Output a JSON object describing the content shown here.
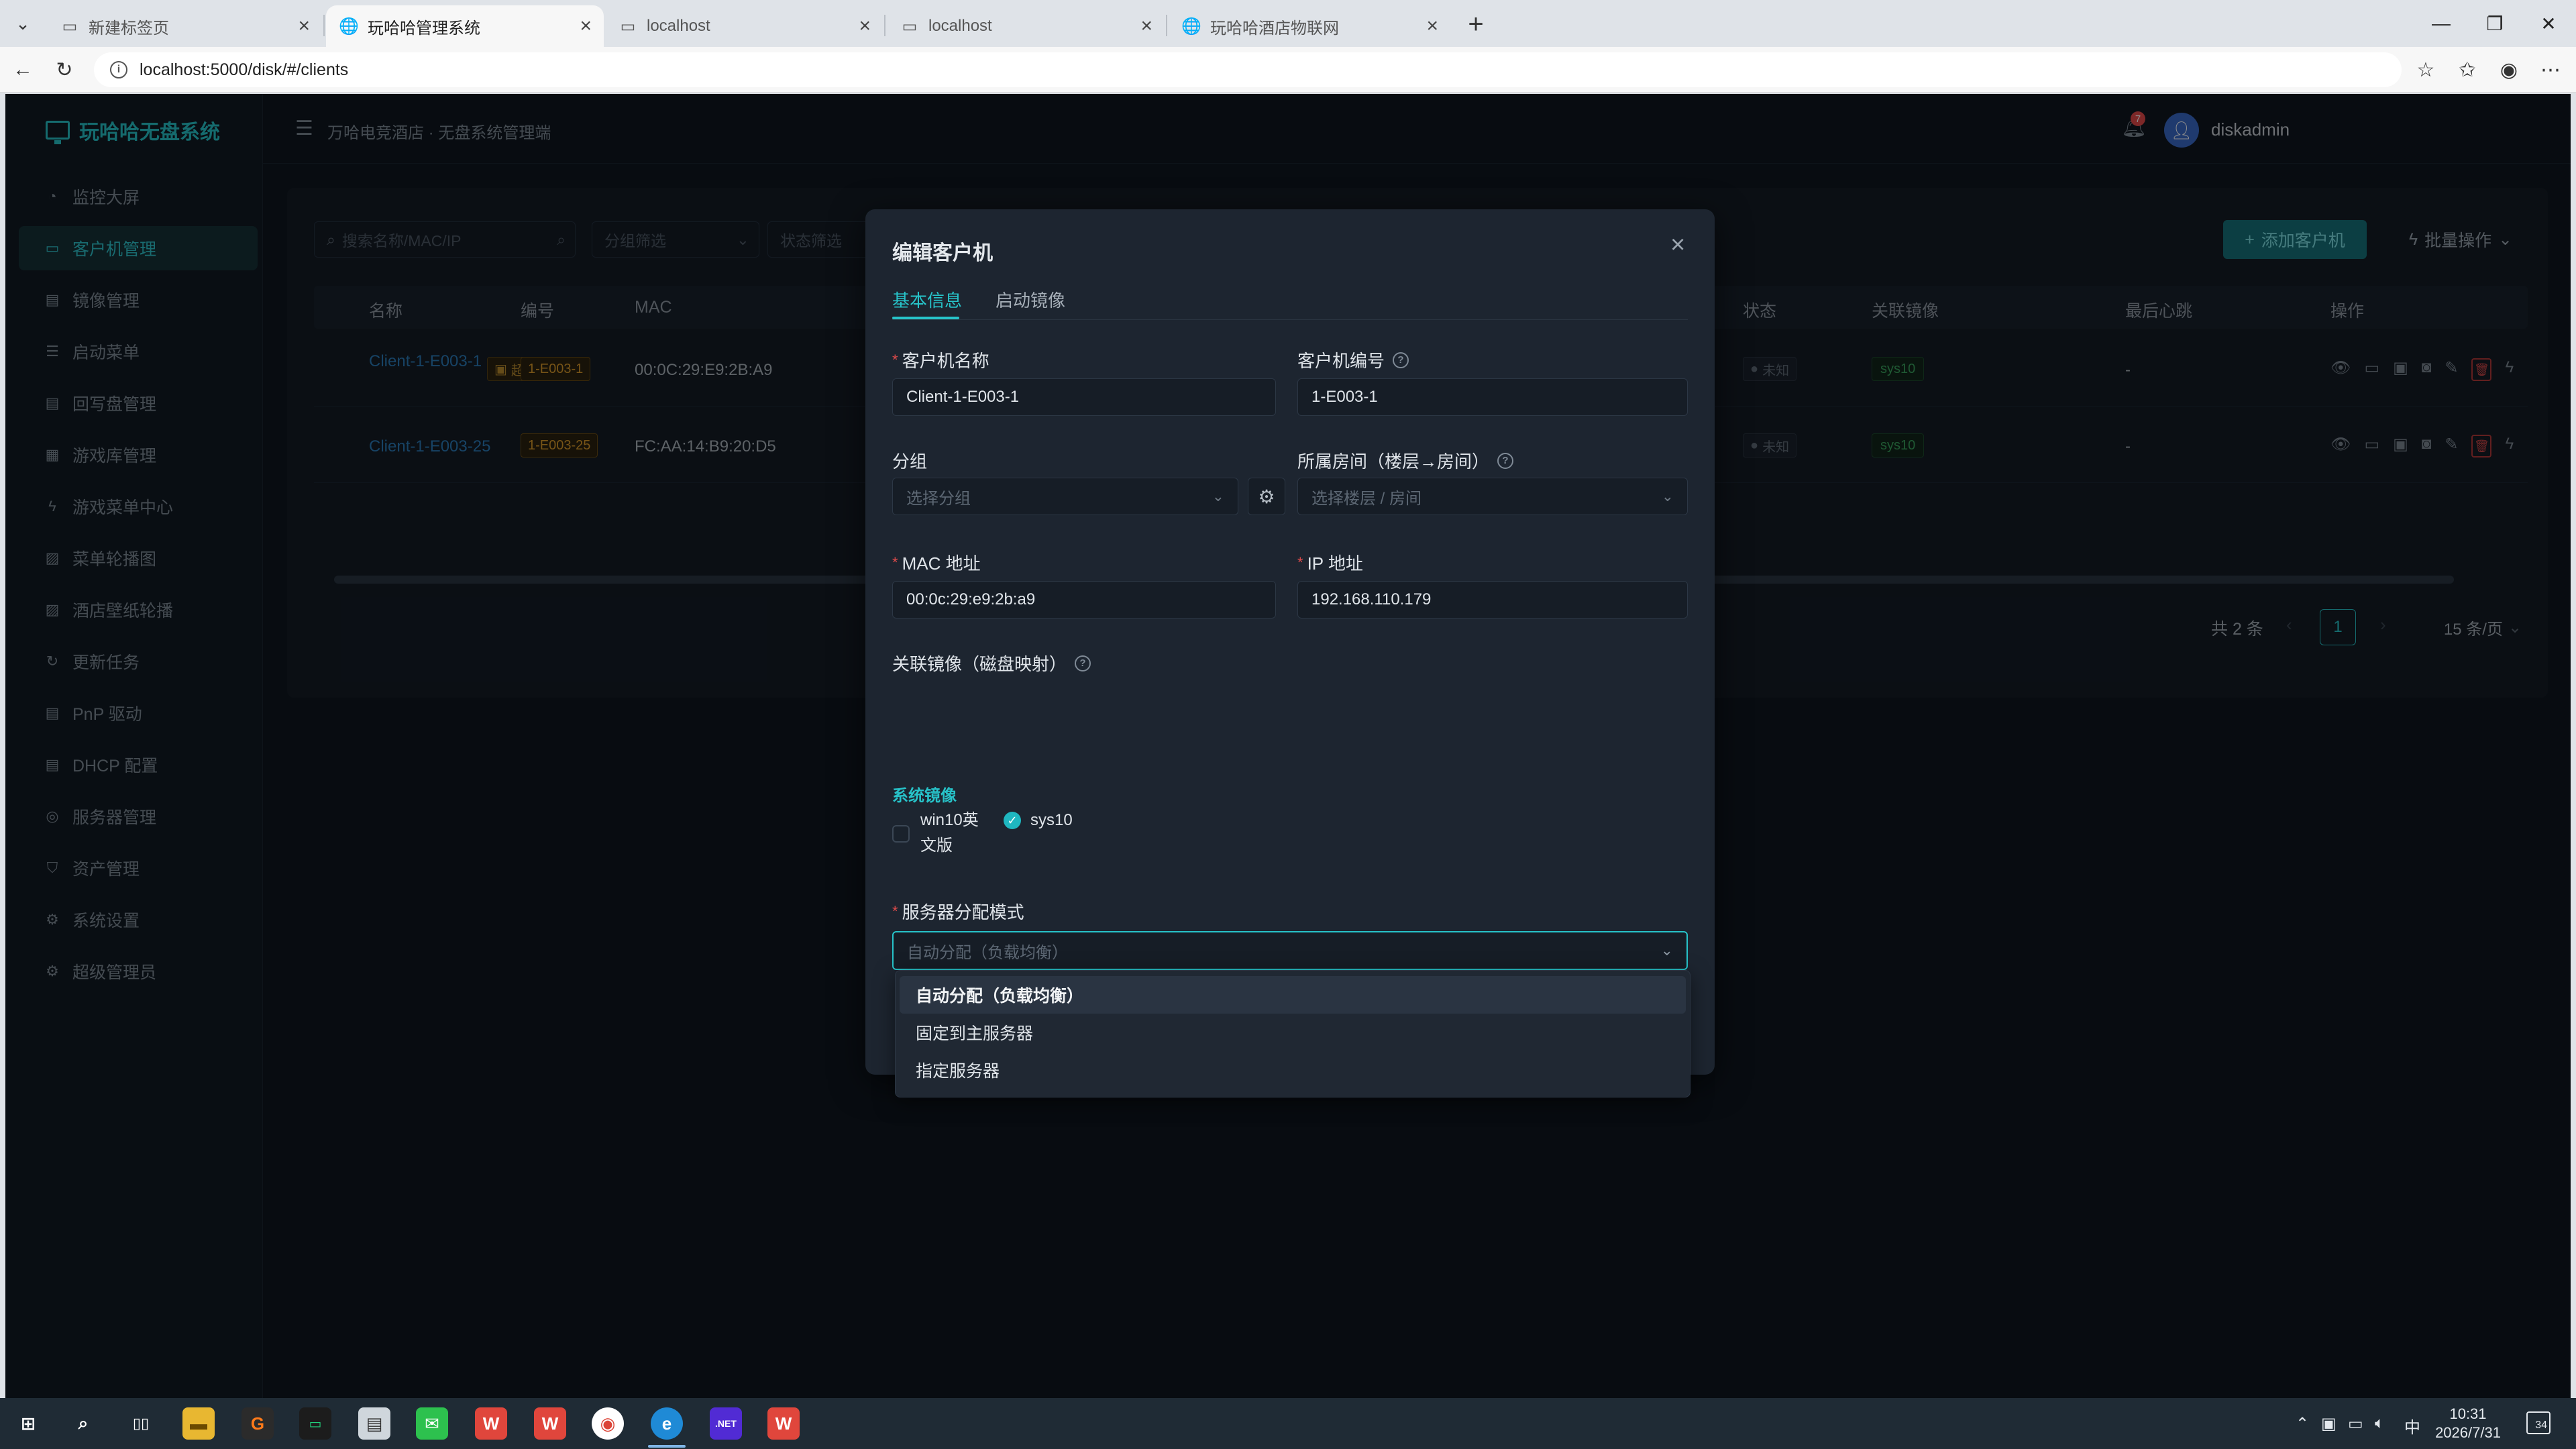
{
  "browser": {
    "tabs": [
      {
        "label": "新建标签页",
        "active": false,
        "icon": "page-icon"
      },
      {
        "label": "玩哈哈管理系统",
        "active": true,
        "icon": "globe-icon"
      },
      {
        "label": "localhost",
        "active": false,
        "icon": "page-icon"
      },
      {
        "label": "localhost",
        "active": false,
        "icon": "page-icon"
      },
      {
        "label": "玩哈哈酒店物联网",
        "active": false,
        "icon": "globe-icon"
      }
    ],
    "url": "localhost:5000/disk/#/clients"
  },
  "app": {
    "logo": "玩哈哈无盘系统",
    "breadcrumb": "万哈电竞酒店 · 无盘系统管理端",
    "notification_count": "7",
    "username": "diskadmin",
    "menu": [
      {
        "label": "监控大屏",
        "icon": "dashboard-icon"
      },
      {
        "label": "客户机管理",
        "icon": "monitor-icon",
        "active": true
      },
      {
        "label": "镜像管理",
        "icon": "image-icon"
      },
      {
        "label": "启动菜单",
        "icon": "list-icon"
      },
      {
        "label": "回写盘管理",
        "icon": "disk-icon"
      },
      {
        "label": "游戏库管理",
        "icon": "grid-icon"
      },
      {
        "label": "游戏菜单中心",
        "icon": "bolt-icon"
      },
      {
        "label": "菜单轮播图",
        "icon": "picture-icon"
      },
      {
        "label": "酒店壁纸轮播",
        "icon": "picture-icon"
      },
      {
        "label": "更新任务",
        "icon": "refresh-icon"
      },
      {
        "label": "PnP 驱动",
        "icon": "driver-icon"
      },
      {
        "label": "DHCP 配置",
        "icon": "network-icon"
      },
      {
        "label": "服务器管理",
        "icon": "server-icon"
      },
      {
        "label": "资产管理",
        "icon": "shield-icon"
      },
      {
        "label": "系统设置",
        "icon": "gear-icon"
      },
      {
        "label": "超级管理员",
        "icon": "admin-icon"
      }
    ]
  },
  "list": {
    "search_placeholder": "搜索名称/MAC/IP",
    "group_filter_placeholder": "分组筛选",
    "status_filter_placeholder": "状态筛选",
    "add_button": "添加客户机",
    "batch_button": "批量操作",
    "columns": {
      "name": "名称",
      "code": "编号",
      "mac": "MAC",
      "status": "状态",
      "image": "关联镜像",
      "heartbeat": "最后心跳",
      "actions": "操作"
    },
    "rows": [
      {
        "name": "Client-1-E003-1",
        "super_tag": "超",
        "code": "1-E003-1",
        "mac": "00:0C:29:E9:2B:A9",
        "status": "未知",
        "image": "sys10",
        "heartbeat": "-"
      },
      {
        "name": "Client-1-E003-25",
        "code": "1-E003-25",
        "mac": "FC:AA:14:B9:20:D5",
        "status": "未知",
        "image": "sys10",
        "heartbeat": "-"
      }
    ],
    "total": "共 2 条",
    "page": "1",
    "page_size": "15 条/页"
  },
  "modal": {
    "title": "编辑客户机",
    "tabs": [
      "基本信息",
      "启动镜像"
    ],
    "fields": {
      "client_name_label": "客户机名称",
      "client_name_value": "Client-1-E003-1",
      "client_code_label": "客户机编号",
      "client_code_value": "1-E003-1",
      "group_label": "分组",
      "group_placeholder": "选择分组",
      "room_label": "所属房间（楼层→房间）",
      "room_placeholder": "选择楼层 / 房间",
      "mac_label": "MAC 地址",
      "mac_value": "00:0c:29:e9:2b:a9",
      "ip_label": "IP 地址",
      "ip_value": "192.168.110.179",
      "image_label": "关联镜像（磁盘映射）",
      "system_image_group": "系统镜像",
      "images": [
        {
          "label": "win10英文版",
          "checked": false
        },
        {
          "label": "sys10",
          "checked": true
        }
      ],
      "mode_label": "服务器分配模式",
      "mode_placeholder": "自动分配（负载均衡）"
    },
    "dropdown": [
      {
        "label": "自动分配（负载均衡）",
        "selected": true
      },
      {
        "label": "固定到主服务器",
        "selected": false
      },
      {
        "label": "指定服务器",
        "selected": false
      }
    ]
  },
  "taskbar": {
    "apps": [
      "windows-start-icon",
      "search-icon",
      "task-view-icon",
      "file-explorer-icon",
      "grammarly-icon",
      "terminal-icon",
      "notepad-icon",
      "wechat-icon",
      "wps-icon",
      "wps-icon",
      "chrome-icon",
      "edge-icon",
      "dotnet-icon",
      "wps-icon"
    ],
    "time": "10:31",
    "date": "2026/7/31",
    "ime": "中",
    "notification_count": "34"
  },
  "colors": {
    "accent": "#27c3c9",
    "background": "#0f161f",
    "danger": "#e04b4b"
  }
}
